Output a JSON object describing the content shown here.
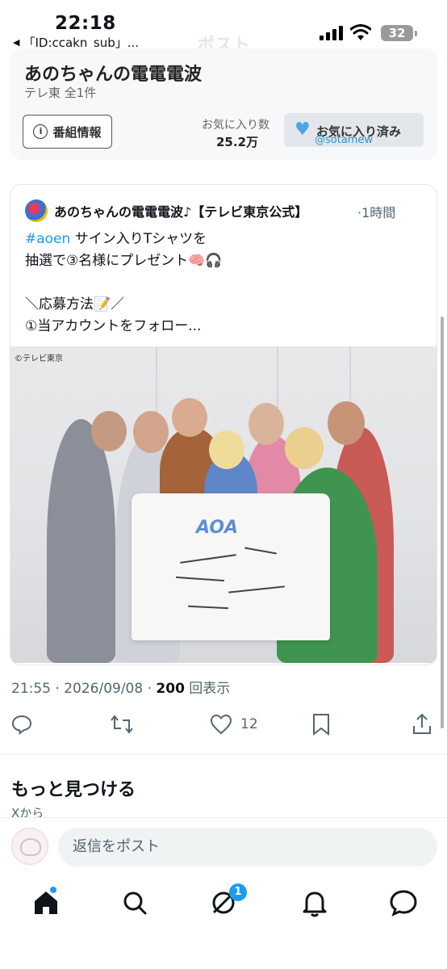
{
  "status_bar": {
    "time": "22:18",
    "back_app_label": "「ID:ccakn_sub」...",
    "battery": "32"
  },
  "header": {
    "title": "ポスト"
  },
  "program": {
    "title": "あのちゃんの電電電波",
    "subtitle": "テレ東  全1件",
    "info_button": "番組情報",
    "favorites_label": "お気に入り数",
    "favorites_count": "25.2万",
    "favorite_button": "お気に入り済み",
    "watermark": "@sotamew"
  },
  "post": {
    "author": "あのちゃんの電電電波♪【テレビ東京公式】",
    "time": "·1時間",
    "hashtag": "#aoen",
    "line1_rest": " サイン入りTシャツを",
    "line2": "抽選で③名様にプレゼント🧠🎧",
    "line3": "＼応募方法📝／",
    "line4": "①当アカウントをフォロー...",
    "image_copyright": "©テレビ東京",
    "image_logo": "AOA",
    "meta_time": "21:55 · 2026/09/08 · ",
    "views_count": "200",
    "views_label": " 回表示",
    "like_count": "12"
  },
  "discover": {
    "title": "もっと見つける",
    "subtitle": "Xから"
  },
  "reply": {
    "placeholder": "返信をポスト"
  },
  "tabs": {
    "badge": "1",
    "items": [
      "home-icon",
      "search-icon",
      "grok-icon",
      "bell-icon",
      "messages-icon"
    ]
  },
  "colors": {
    "accent": "#1d9bf0",
    "favorite_heart": "#4aa6e6"
  }
}
